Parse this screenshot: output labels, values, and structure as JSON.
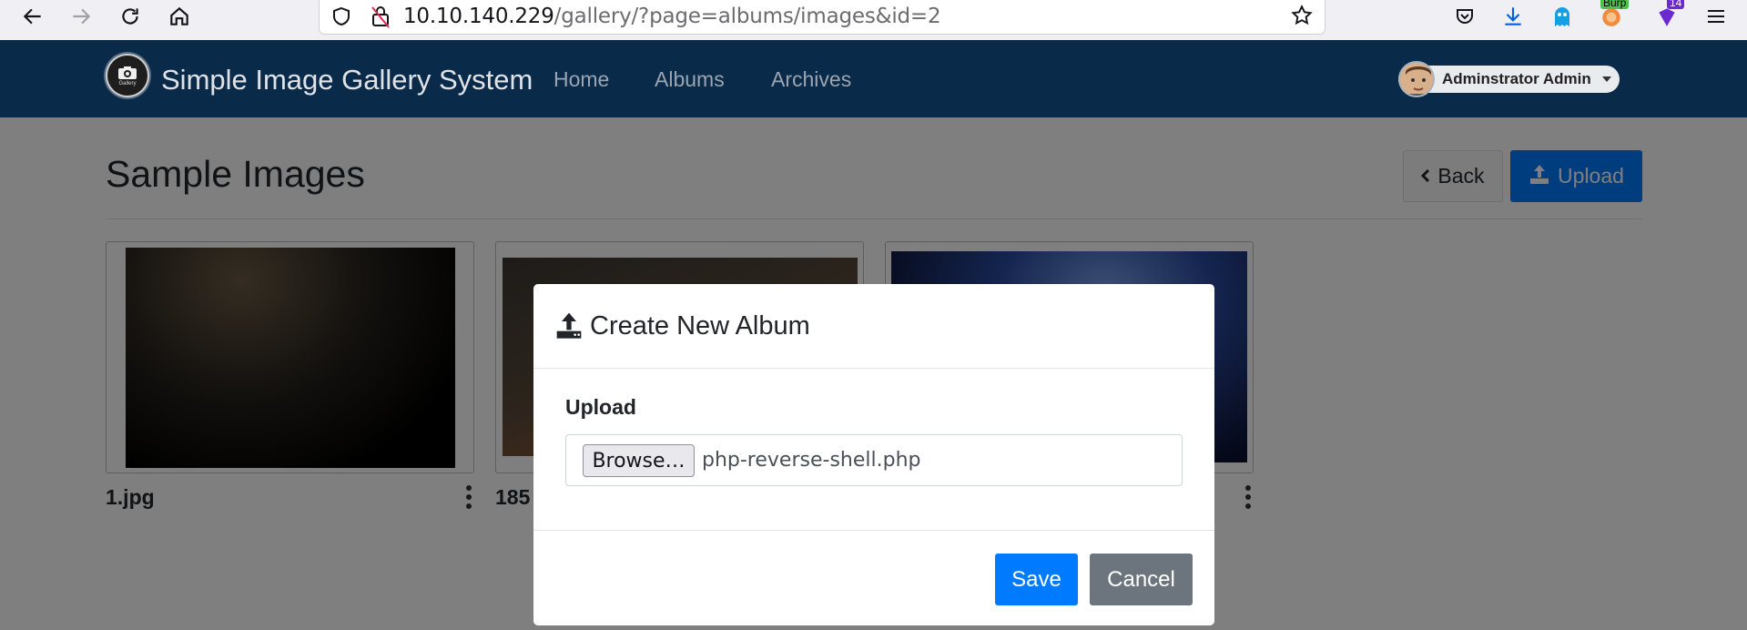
{
  "browser": {
    "url_host": "10.10.140.229",
    "url_path": "/gallery/?page=albums/images&id=2",
    "extensions": [
      {
        "name": "pocket-icon"
      },
      {
        "name": "downloads-icon"
      },
      {
        "name": "ghost-icon"
      },
      {
        "name": "burp-icon",
        "badge": "Burp"
      },
      {
        "name": "extension-icon",
        "badge": "14"
      }
    ]
  },
  "site": {
    "brand": "Simple Image Gallery System",
    "logo_caption": "Gallery",
    "nav": [
      "Home",
      "Albums",
      "Archives"
    ],
    "user": "Adminstrator Admin"
  },
  "page": {
    "title": "Sample Images",
    "back_label": "Back",
    "upload_label": "Upload",
    "thumbnails": [
      {
        "label": "1.jpg"
      },
      {
        "label": "185"
      },
      {
        "label": ""
      }
    ]
  },
  "modal": {
    "title": "Create New Album",
    "field_label": "Upload",
    "browse_label": "Browse…",
    "file_name": "php-reverse-shell.php",
    "save_label": "Save",
    "cancel_label": "Cancel"
  },
  "colors": {
    "navbar": "#0a2a4a",
    "primary": "#007bff",
    "secondary": "#6c757d"
  }
}
